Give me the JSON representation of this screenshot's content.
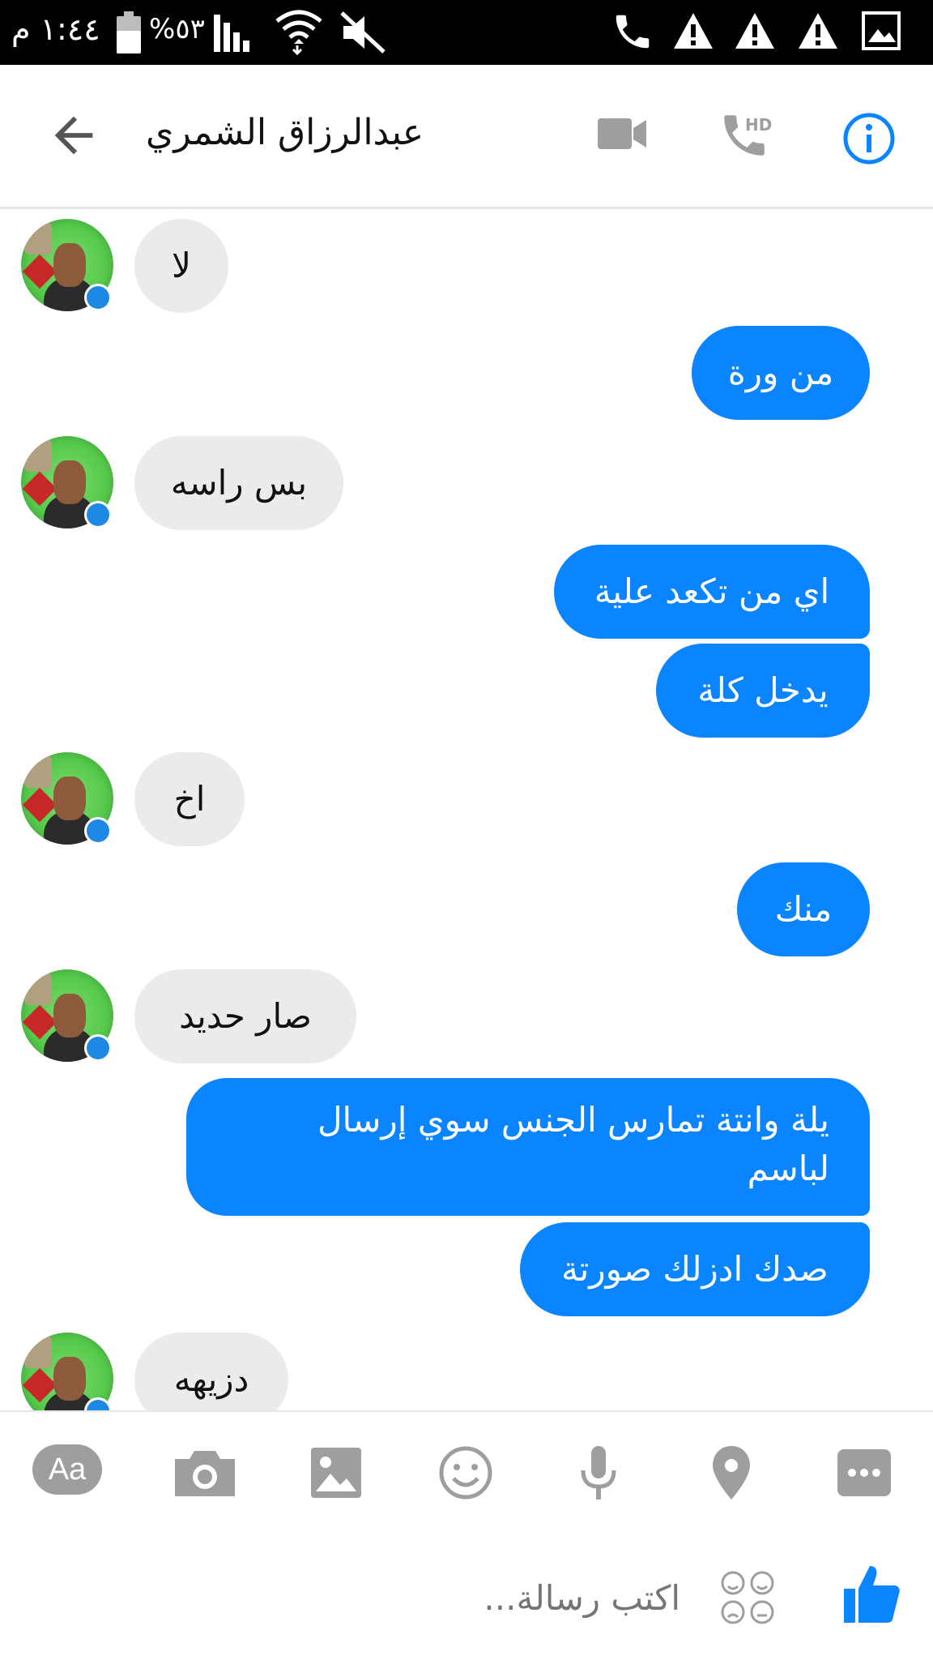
{
  "status_bar": {
    "time": "١:٤٤ م",
    "battery": "%٥٣",
    "icons": [
      "phone-icon",
      "warning-icon",
      "warning-icon",
      "warning-icon",
      "image-icon",
      "mute-icon",
      "wifi-icon",
      "signal-icon",
      "battery-icon"
    ]
  },
  "header": {
    "contact_name": "عبدالرزاق الشمري",
    "hd_label": "HD",
    "icons": [
      "back-arrow-icon",
      "video-call-icon",
      "phone-hd-icon",
      "info-icon"
    ],
    "accent_color": "#0a84ff"
  },
  "messages": [
    {
      "direction": "in",
      "text": "لا"
    },
    {
      "direction": "out",
      "text": "من ورة"
    },
    {
      "direction": "in",
      "text": "بس راسه"
    },
    {
      "direction": "out",
      "text": "اي من تكعد علية"
    },
    {
      "direction": "out",
      "text": "يدخل كلة"
    },
    {
      "direction": "in",
      "text": "اخ"
    },
    {
      "direction": "out",
      "text": "منك"
    },
    {
      "direction": "in",
      "text": "صار حديد"
    },
    {
      "direction": "out",
      "text": "يلة وانتة تمارس الجنس سوي إرسال لباسم"
    },
    {
      "direction": "out",
      "text": "صدك ادزلك صورتة"
    },
    {
      "direction": "in",
      "text": "دزيهه"
    }
  ],
  "toolbar": {
    "text_button": "Aa",
    "icons": [
      "text-format-icon",
      "camera-icon",
      "gallery-icon",
      "emoji-icon",
      "microphone-icon",
      "location-icon",
      "more-icon"
    ]
  },
  "composer": {
    "placeholder": "اكتب رسالة...",
    "icons": [
      "stickers-icon",
      "like-icon"
    ]
  },
  "colors": {
    "outgoing_bubble": "#0a84ff",
    "incoming_bubble": "#ebebeb",
    "status_bar": "#000000",
    "icon_gray": "#9e9e9e"
  }
}
